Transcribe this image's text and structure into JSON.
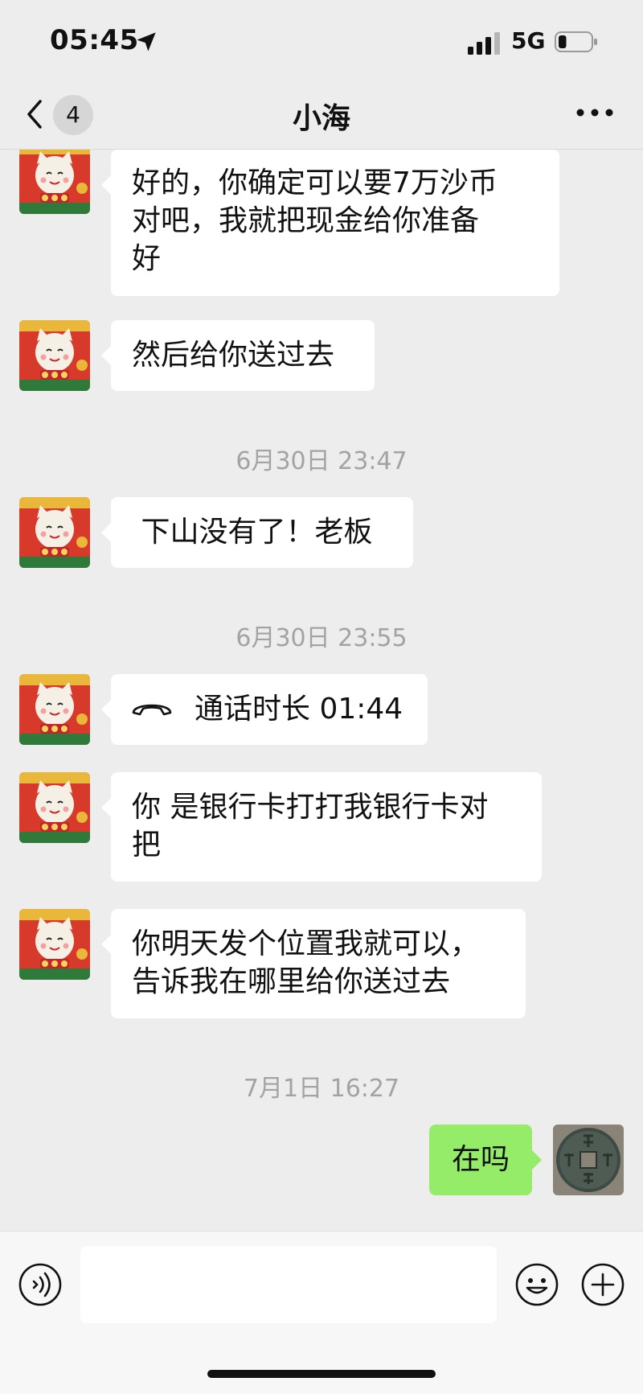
{
  "status_bar": {
    "time": "05:45",
    "network": "5G",
    "battery_level": 0.25
  },
  "nav": {
    "back_badge": "4",
    "title": "小海"
  },
  "messages": [
    {
      "type": "text",
      "side": "left",
      "text": "好的，你确定可以要7万沙币\n对吧，我就把现金给你准备\n好"
    },
    {
      "type": "text",
      "side": "left",
      "text": "然后给你送过去"
    },
    {
      "type": "timestamp",
      "text": "6月30日 23:47"
    },
    {
      "type": "text",
      "side": "left",
      "text": " 下山没有了！老板"
    },
    {
      "type": "timestamp",
      "text": "6月30日 23:55"
    },
    {
      "type": "call",
      "side": "left",
      "text": "通话时长 01:44"
    },
    {
      "type": "text",
      "side": "left",
      "text": "你 是银行卡打打我银行卡对\n把"
    },
    {
      "type": "text",
      "side": "left",
      "text": "你明天发个位置我就可以，\n告诉我在哪里给你送过去"
    },
    {
      "type": "timestamp",
      "text": "7月1日 16:27"
    },
    {
      "type": "text",
      "side": "right",
      "text": "在吗"
    }
  ],
  "icons": {
    "back": "chevron-left-icon",
    "more": "more-dots-icon",
    "voice": "voice-icon",
    "emoji": "emoji-icon",
    "plus": "plus-icon",
    "call": "phone-handset-icon"
  },
  "colors": {
    "self_bubble": "#95ec69",
    "other_bubble": "#ffffff",
    "background": "#ededed",
    "timestamp": "#a3a3a3"
  }
}
